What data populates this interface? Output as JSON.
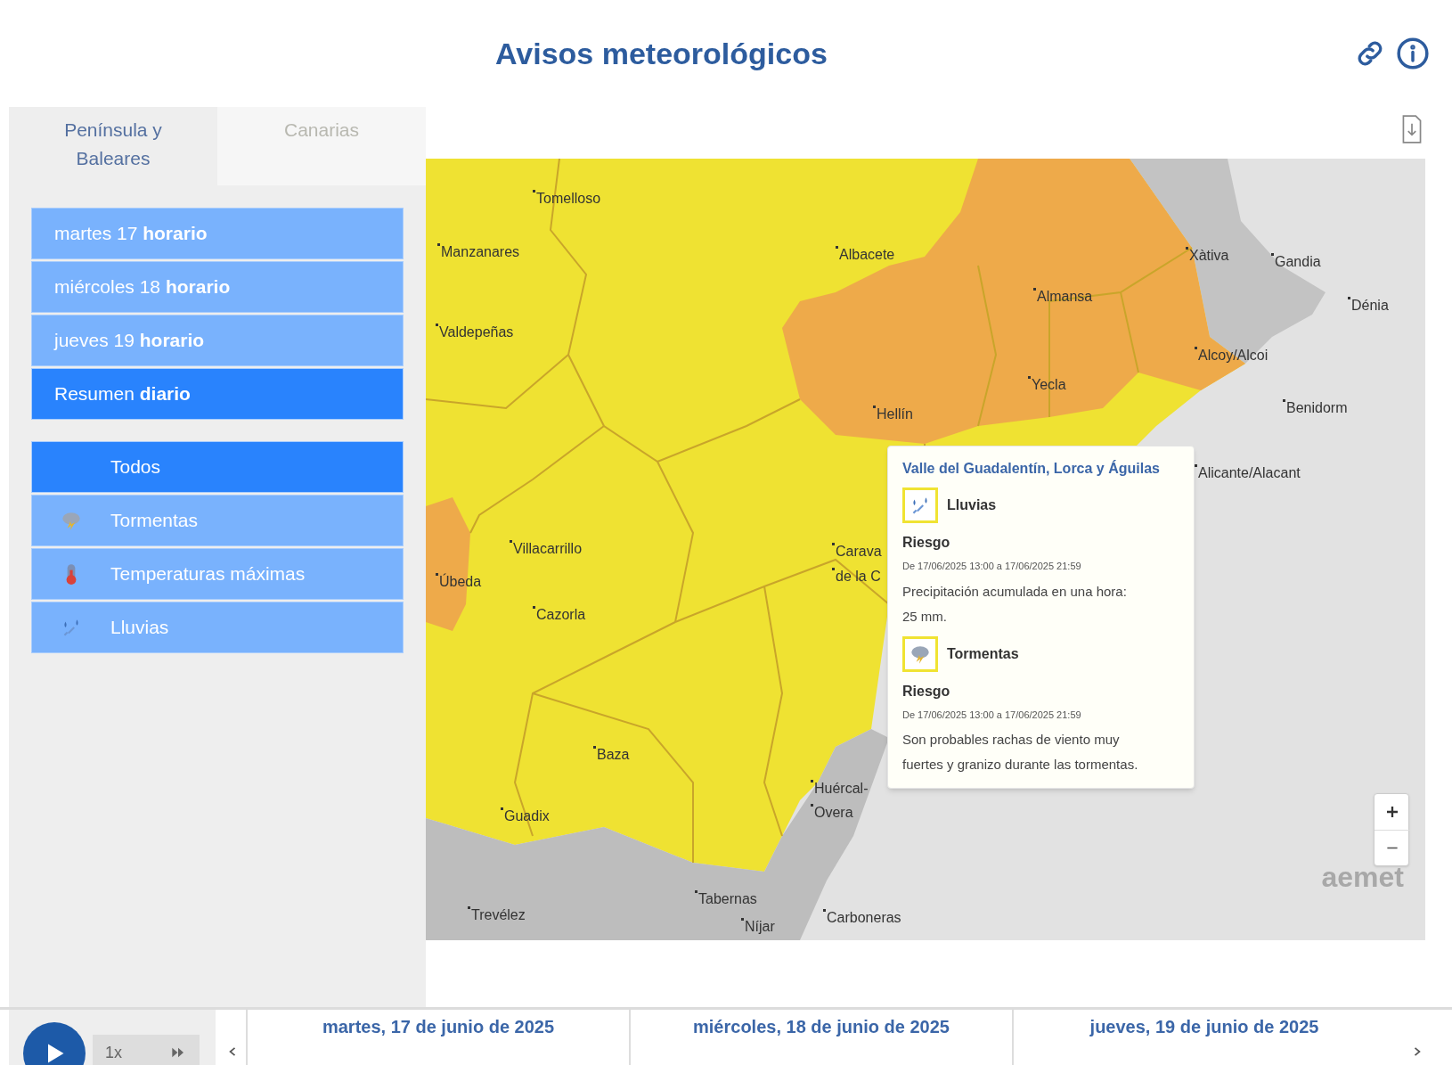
{
  "header": {
    "title": "Avisos meteorológicos"
  },
  "region_tabs": [
    {
      "label": "Península y Baleares",
      "selected": true
    },
    {
      "label": "Canarias",
      "selected": false
    }
  ],
  "day_options": [
    {
      "label": "martes 17 **horario**",
      "selected": false
    },
    {
      "label": "miércoles 18 **horario**",
      "selected": false
    },
    {
      "label": "jueves 19 **horario**",
      "selected": false
    },
    {
      "label": "Resumen **diario**",
      "selected": true
    }
  ],
  "phenomena": [
    {
      "kind": "all",
      "label": "Todos",
      "selected": true
    },
    {
      "kind": "storm",
      "label": "Tormentas",
      "selected": false
    },
    {
      "kind": "heat",
      "label": "Temperaturas máximas",
      "selected": false
    },
    {
      "kind": "rain",
      "label": "Lluvias",
      "selected": false
    }
  ],
  "map": {
    "places": [
      "Tomelloso",
      "Manzanares",
      "Valdepeñas",
      "Albacete",
      "Almansa",
      "Xàtiva",
      "Gandia",
      "Dénia",
      "Alcoy/Alcoi",
      "Yecla",
      "Benidorm",
      "Hellín",
      "Alicante/Alacant",
      "Villacarrillo",
      "Úbeda",
      "Cazorla",
      "Carava",
      "de la C",
      "Baza",
      "Guadix",
      "Huércal-",
      "Overa",
      "Tabernas",
      "Níjar",
      "Carboneras",
      "Trevélez"
    ],
    "logo": "aemet",
    "popup": {
      "title": "Valle del Guadalentín, Lorca y Águilas",
      "warnings": [
        {
          "kind": "rain",
          "name": "Lluvias",
          "level_label": "Riesgo",
          "period": "De 17/06/2025 13:00 a 17/06/2025 21:59",
          "description": "Precipitación acumulada en una hora: 25 mm."
        },
        {
          "kind": "storm",
          "name": "Tormentas",
          "level_label": "Riesgo",
          "period": "De 17/06/2025 13:00 a 17/06/2025 21:59",
          "description": "Son probables rachas de viento muy fuertes y granizo durante las tormentas."
        }
      ]
    }
  },
  "timeline": {
    "speed": "1x",
    "days": [
      "martes, 17 de junio de 2025",
      "miércoles, 18 de junio de 2025",
      "jueves, 19 de junio de 2025"
    ]
  }
}
